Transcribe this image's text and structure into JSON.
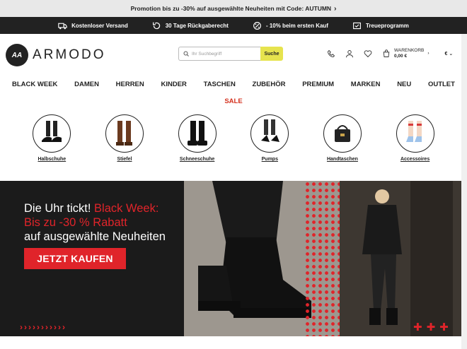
{
  "promo": {
    "text": "Promotion bis zu -30% auf ausgewählte Neuheiten mit Code: AUTUMN",
    "chevron": "›"
  },
  "benefits": [
    {
      "icon": "truck-icon",
      "label": "Kostenloser Versand"
    },
    {
      "icon": "return-icon",
      "label": "30 Tage Rückgaberecht"
    },
    {
      "icon": "discount-icon",
      "label": "- 10% beim ersten Kauf"
    },
    {
      "icon": "loyalty-icon",
      "label": "Treueprogramm"
    }
  ],
  "header": {
    "logo_text": "ARMODO",
    "search_placeholder": "Ihr Suchbegriff",
    "search_button": "Suche",
    "cart_label": "WARENKORB",
    "cart_total": "0,00 €",
    "currency": "€"
  },
  "nav": [
    "BLACK WEEK",
    "DAMEN",
    "HERREN",
    "KINDER",
    "TASCHEN",
    "ZUBEHÖR",
    "PREMIUM",
    "MARKEN",
    "NEU",
    "OUTLET"
  ],
  "sale_label": "SALE",
  "categories": [
    "Halbschuhe",
    "Stiefel",
    "Schneeschuhe",
    "Pumps",
    "Handtaschen",
    "Accessoires"
  ],
  "banner": {
    "line1_white": "Die Uhr tickt! ",
    "line1_red": "Black Week:",
    "line2_red": "Bis zu -30 % Rabatt",
    "line3_white": "auf ausgewählte Neuheiten",
    "cta": "JETZT KAUFEN",
    "chevrons": "›››››››››››",
    "crosses": "✚✚✚"
  },
  "colors": {
    "accent_red": "#e0242a",
    "sale_red": "#d4311e",
    "search_yellow": "#e6e34e",
    "dark": "#222222"
  }
}
